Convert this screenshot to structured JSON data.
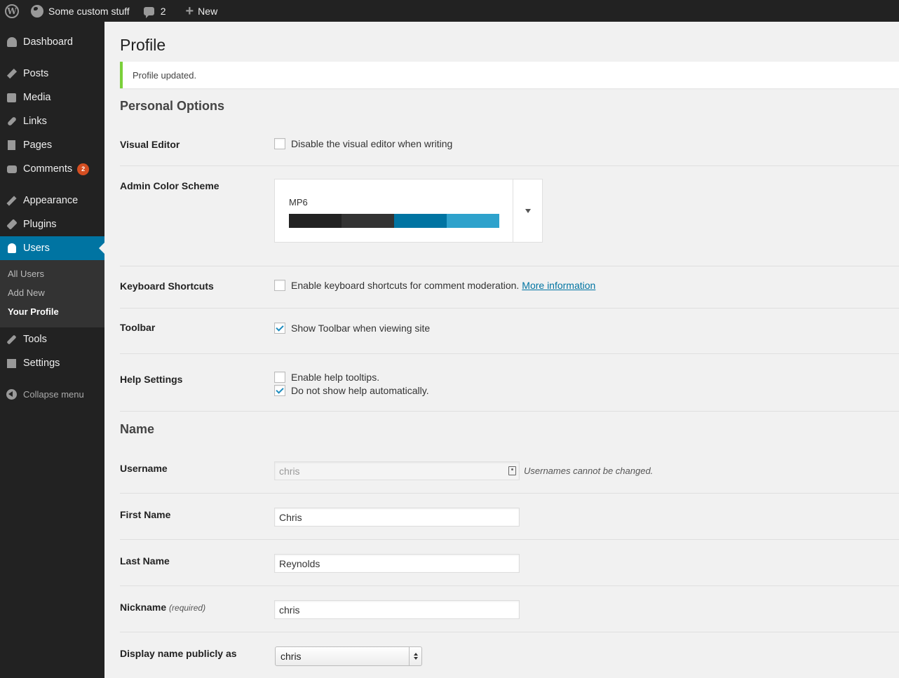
{
  "admin_bar": {
    "site_name": "Some custom stuff",
    "comments_count": "2",
    "new_label": "New"
  },
  "sidebar": {
    "items": [
      {
        "label": "Dashboard",
        "icon": "dashboard-icon"
      },
      {
        "label": "Posts",
        "icon": "pushpin-icon"
      },
      {
        "label": "Media",
        "icon": "media-icon"
      },
      {
        "label": "Links",
        "icon": "link-icon"
      },
      {
        "label": "Pages",
        "icon": "pages-icon"
      },
      {
        "label": "Comments",
        "icon": "comment-icon",
        "badge": "2"
      },
      {
        "label": "Appearance",
        "icon": "brush-icon"
      },
      {
        "label": "Plugins",
        "icon": "plug-icon"
      },
      {
        "label": "Users",
        "icon": "user-icon"
      },
      {
        "label": "Tools",
        "icon": "wrench-icon"
      },
      {
        "label": "Settings",
        "icon": "settings-icon"
      }
    ],
    "submenu": [
      "All Users",
      "Add New",
      "Your Profile"
    ],
    "collapse_label": "Collapse menu"
  },
  "page": {
    "title": "Profile",
    "notice": "Profile updated."
  },
  "personal_options": {
    "heading": "Personal Options",
    "visual_editor": {
      "label": "Visual Editor",
      "option": "Disable the visual editor when writing",
      "checked": false
    },
    "color_scheme": {
      "label": "Admin Color Scheme",
      "selected": "MP6",
      "colors": [
        "#222222",
        "#333333",
        "#0074a2",
        "#2ea2cc"
      ]
    },
    "keyboard_shortcuts": {
      "label": "Keyboard Shortcuts",
      "option": "Enable keyboard shortcuts for comment moderation.",
      "link": "More information",
      "checked": false
    },
    "toolbar": {
      "label": "Toolbar",
      "option": "Show Toolbar when viewing site",
      "checked": true
    },
    "help_settings": {
      "label": "Help Settings",
      "option1": "Enable help tooltips.",
      "option2": "Do not show help automatically."
    }
  },
  "name": {
    "heading": "Name",
    "username": {
      "label": "Username",
      "value": "chris",
      "hint": "Usernames cannot be changed."
    },
    "first_name": {
      "label": "First Name",
      "value": "Chris"
    },
    "last_name": {
      "label": "Last Name",
      "value": "Reynolds"
    },
    "nickname": {
      "label": "Nickname",
      "required": "(required)",
      "value": "chris"
    },
    "display_name": {
      "label": "Display name publicly as",
      "value": "chris"
    }
  }
}
